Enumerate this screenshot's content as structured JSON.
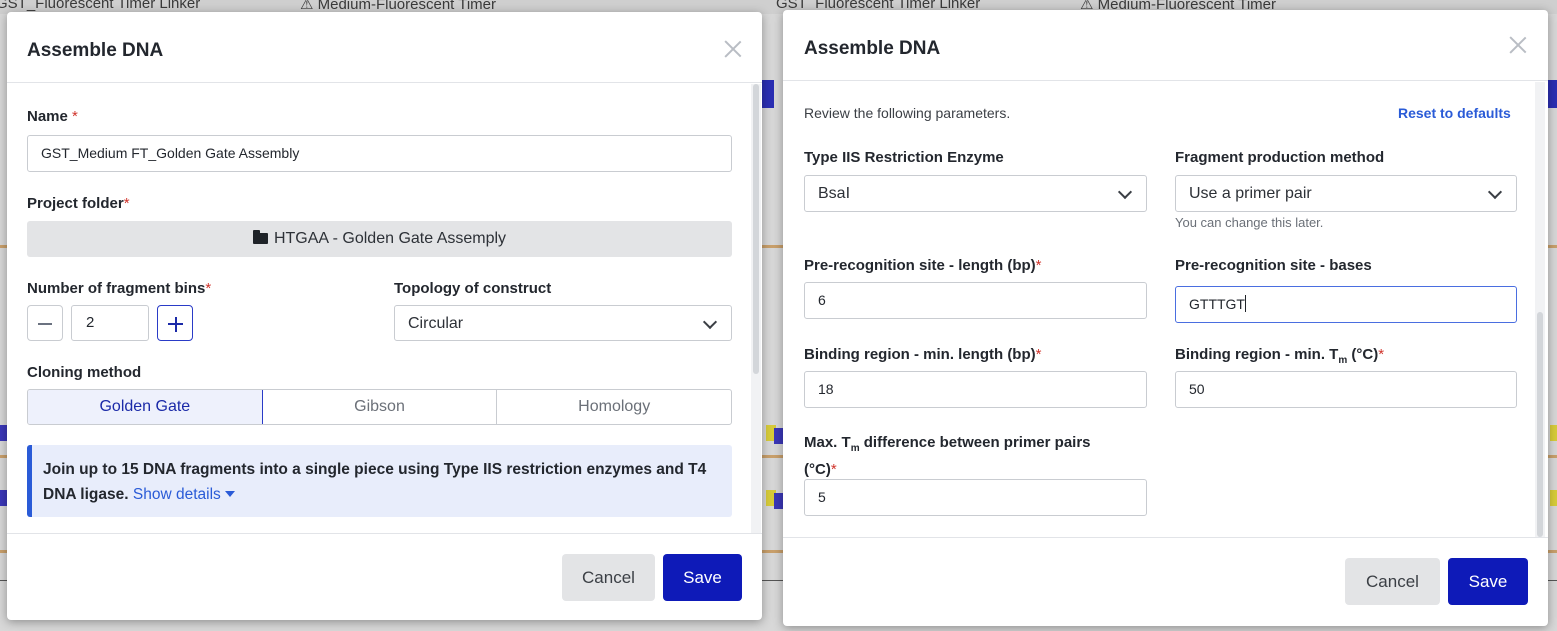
{
  "background": {
    "tabs": [
      "GST_Fluorescent Timer Linker",
      "Medium-Fluorescent Timer",
      "GST_Fluorescent Timer Linker",
      "Medium-Fluorescent Timer"
    ]
  },
  "left_modal": {
    "title": "Assemble DNA",
    "name_label": "Name",
    "name_value": "GST_Medium FT_Golden Gate Assembly",
    "project_folder_label": "Project folder",
    "project_folder_value": "HTGAA - Golden Gate Assemply",
    "fragment_bins_label": "Number of fragment bins",
    "fragment_bins_value": "2",
    "topology_label": "Topology of construct",
    "topology_value": "Circular",
    "cloning_method_label": "Cloning method",
    "cloning_methods": [
      "Golden Gate",
      "Gibson",
      "Homology"
    ],
    "selected_method": "Golden Gate",
    "info_text": "Join up to 15 DNA fragments into a single piece using Type IIS restriction enzymes and T4 DNA ligase.",
    "info_link": "Show details",
    "cancel_label": "Cancel",
    "save_label": "Save"
  },
  "right_modal": {
    "title": "Assemble DNA",
    "review_text": "Review the following parameters.",
    "reset_label": "Reset to defaults",
    "enzyme_label": "Type IIS Restriction Enzyme",
    "enzyme_value": "BsaI",
    "fragment_method_label": "Fragment production method",
    "fragment_method_value": "Use a primer pair",
    "fragment_method_hint": "You can change this later.",
    "pre_length_label": "Pre-recognition site - length (bp)",
    "pre_length_value": "6",
    "pre_bases_label": "Pre-recognition site - bases",
    "pre_bases_value": "GTTTGT",
    "binding_len_label": "Binding region - min. length (bp)",
    "binding_len_value": "18",
    "binding_tm_label_pre": "Binding region - min. T",
    "binding_tm_label_sub": "m",
    "binding_tm_label_post": " (°C)",
    "binding_tm_value": "50",
    "max_tm_label_pre": "Max. T",
    "max_tm_label_sub": "m",
    "max_tm_label_post": " difference between primer pairs",
    "max_tm_label_unit": "(°C)",
    "max_tm_value": "5",
    "cancel_label": "Cancel",
    "save_label": "Save"
  },
  "colors": {
    "primary": "#0e1ab8",
    "link": "#2a5bd7",
    "required": "#d0342c",
    "info_bg": "#e8edfb"
  },
  "icons": [
    "close-icon",
    "folder-icon",
    "minus-icon",
    "plus-icon",
    "chevron-down-icon",
    "caret-down-icon"
  ]
}
